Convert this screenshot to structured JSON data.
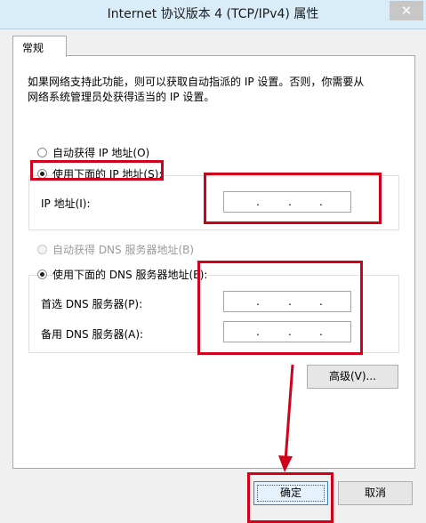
{
  "window": {
    "title": "Internet 协议版本 4 (TCP/IPv4) 属性",
    "close_glyph": "✕"
  },
  "tab": {
    "label": "常规"
  },
  "description": {
    "line1": "如果网络支持此功能，则可以获取自动指派的 IP 设置。否则，你需要从",
    "line2": "网络系统管理员处获得适当的 IP 设置。"
  },
  "ip": {
    "auto_label": "自动获得 IP 地址(O)",
    "manual_label": "使用下面的 IP 地址(S):",
    "selected": "manual",
    "address_label": "IP 地址(I):",
    "address_value": ". . ."
  },
  "dns": {
    "auto_label": "自动获得 DNS 服务器地址(B)",
    "manual_label": "使用下面的 DNS 服务器地址(E):",
    "selected": "manual",
    "preferred_label": "首选 DNS 服务器(P):",
    "alternate_label": "备用 DNS 服务器(A):"
  },
  "buttons": {
    "advanced": "高级(V)...",
    "ok": "确定",
    "cancel": "取消"
  },
  "annotation_color": "#d0021b"
}
